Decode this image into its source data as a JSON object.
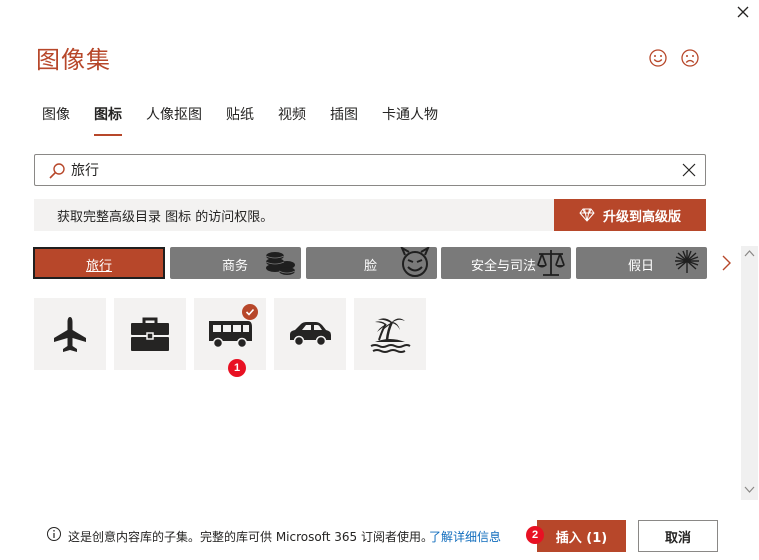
{
  "dialog": {
    "title": "图像集",
    "close_icon": "close-icon",
    "feedback": {
      "happy_icon": "smiley-happy-icon",
      "sad_icon": "smiley-sad-icon"
    }
  },
  "tabs": [
    {
      "label": "图像",
      "active": false
    },
    {
      "label": "图标",
      "active": true
    },
    {
      "label": "人像抠图",
      "active": false
    },
    {
      "label": "贴纸",
      "active": false
    },
    {
      "label": "视频",
      "active": false
    },
    {
      "label": "插图",
      "active": false
    },
    {
      "label": "卡通人物",
      "active": false
    }
  ],
  "search": {
    "value": "旅行",
    "search_icon": "search-icon",
    "clear_icon": "close-icon"
  },
  "banner": {
    "text": "获取完整高级目录 图标 的访问权限。",
    "upgrade_label": "升级到高级版",
    "upgrade_icon": "diamond-icon"
  },
  "categories": [
    {
      "label": "旅行",
      "active": true
    },
    {
      "label": "商务",
      "art": "coins-icon"
    },
    {
      "label": "脸",
      "art": "devil-face-icon"
    },
    {
      "label": "安全与司法",
      "art": "scales-icon"
    },
    {
      "label": "假日",
      "art": "fireworks-icon"
    }
  ],
  "icon_results": [
    {
      "icon": "airplane-icon",
      "selected": false
    },
    {
      "icon": "briefcase-icon",
      "selected": false
    },
    {
      "icon": "bus-icon",
      "selected": true
    },
    {
      "icon": "car-icon",
      "selected": false
    },
    {
      "icon": "island-icon",
      "selected": false
    }
  ],
  "step_badges": {
    "first": "1",
    "second": "2"
  },
  "footer": {
    "info_text": "这是创意内容库的子集。完整的库可供 Microsoft 365 订阅者使用。",
    "learn_more": "了解详细信息",
    "insert_label": "插入 (1)",
    "cancel_label": "取消"
  },
  "colors": {
    "accent": "#b7472a",
    "badge": "#e81123",
    "link": "#0f6cbd",
    "tile": "#f3f2f1",
    "category": "#7a7a7a"
  }
}
